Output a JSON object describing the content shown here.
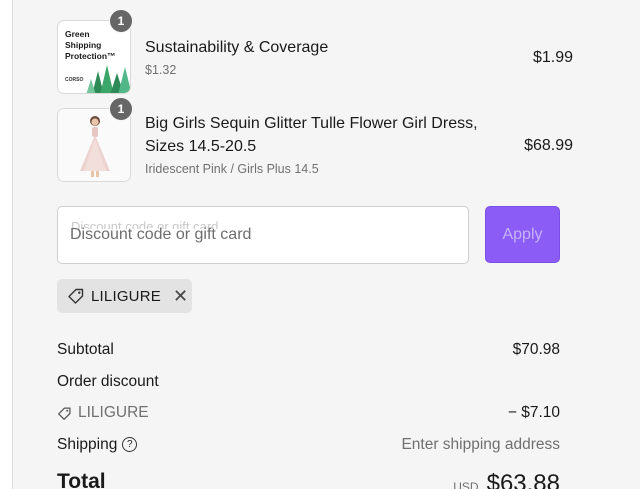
{
  "line_items": [
    {
      "quantity": "1",
      "thumb_text": [
        "Green",
        "Shipping",
        "Protection™"
      ],
      "thumb_brand": "CORSO",
      "title": "Sustainability & Coverage",
      "subtitle": "$1.32",
      "price": "$1.99"
    },
    {
      "quantity": "1",
      "title": "Big Girls Sequin Glitter Tulle Flower Girl Dress, Sizes 14.5-20.5",
      "subtitle": "Iridescent Pink / Girls Plus 14.5",
      "price": "$68.99"
    }
  ],
  "discount": {
    "ghost_label": "Discount code or gift card",
    "placeholder": "Discount code or gift card",
    "apply_label": "Apply"
  },
  "applied_code": {
    "code": "LILIGURE"
  },
  "summary": {
    "subtotal_label": "Subtotal",
    "subtotal_value": "$70.98",
    "order_discount_label": "Order discount",
    "code_label": "LILIGURE",
    "code_value": "− $7.10",
    "shipping_label": "Shipping",
    "shipping_value": "Enter shipping address",
    "total_label": "Total",
    "total_currency": "USD",
    "total_value": "$63.88"
  },
  "colors": {
    "accent": "#8b5cf6",
    "panel_bg": "#f5f5f5",
    "badge": "#666666"
  }
}
